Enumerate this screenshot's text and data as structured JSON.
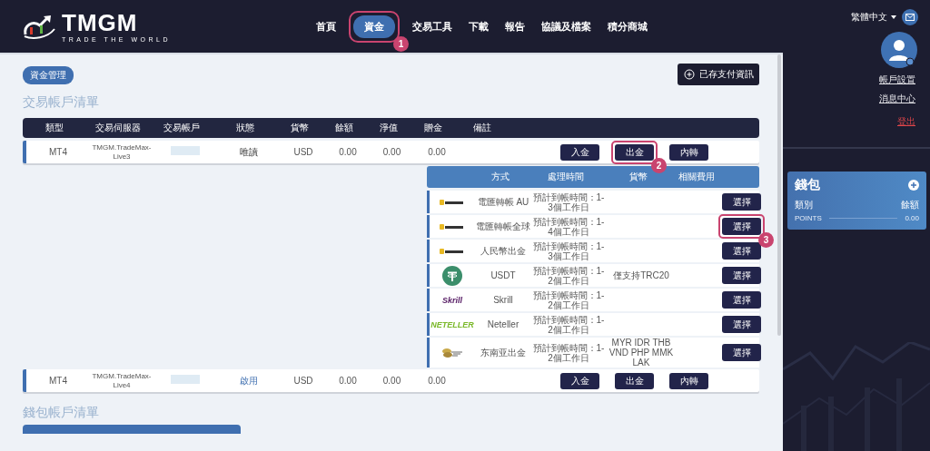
{
  "logo": {
    "name": "TMGM",
    "tagline": "TRADE THE WORLD"
  },
  "nav": [
    {
      "label": "首頁",
      "selected": false
    },
    {
      "label": "資金",
      "selected": true,
      "callout": "1"
    },
    {
      "label": "交易工具",
      "selected": false
    },
    {
      "label": "下載",
      "selected": false
    },
    {
      "label": "報告",
      "selected": false
    },
    {
      "label": "協議及檔案",
      "selected": false
    },
    {
      "label": "積分商城",
      "selected": false
    }
  ],
  "sidebar": {
    "language": "繁體中文",
    "links": [
      {
        "label": "帳戶設置",
        "kind": "normal"
      },
      {
        "label": "消息中心",
        "kind": "normal"
      },
      {
        "label": "登出",
        "kind": "danger"
      }
    ],
    "wallet": {
      "title": "錢包",
      "columns": [
        "類別",
        "餘額"
      ],
      "rows": [
        {
          "name": "POINTS",
          "balance": "0.00"
        }
      ]
    }
  },
  "breadcrumb": "資金管理",
  "saved_payment_button": "已存支付資訊",
  "trading_section_title": "交易帳戶清單",
  "table": {
    "columns": [
      "類型",
      "交易伺服器",
      "交易帳戶",
      "狀態",
      "貨幣",
      "餘額",
      "淨值",
      "贈金",
      "備註"
    ],
    "rows": [
      {
        "type": "MT4",
        "server": "TMGM.TradeMax-Live3",
        "status": "唯讀",
        "enabled": false,
        "currency": "USD",
        "balance": "0.00",
        "equity": "0.00",
        "bonus": "0.00",
        "expanded": true,
        "actions": [
          {
            "label": "入金"
          },
          {
            "label": "出金",
            "callout": "2"
          },
          {
            "label": "內轉"
          }
        ]
      },
      {
        "type": "MT4",
        "server": "TMGM.TradeMax-Live4",
        "status": "啟用",
        "enabled": true,
        "currency": "USD",
        "balance": "0.00",
        "equity": "0.00",
        "bonus": "0.00",
        "expanded": false,
        "actions": [
          {
            "label": "入金"
          },
          {
            "label": "出金"
          },
          {
            "label": "內轉"
          }
        ]
      }
    ]
  },
  "methods": {
    "columns": [
      "方式",
      "處理時間",
      "貨幣",
      "相關費用"
    ],
    "rows": [
      {
        "logo": {
          "kind": "card"
        },
        "name": "電匯轉帳 AU",
        "time": "預計到帳時間：1-3個工作日",
        "button": "選擇"
      },
      {
        "logo": {
          "kind": "card"
        },
        "name": "電匯轉帳全球",
        "time": "預計到帳時間：1-4個工作日",
        "button": "選擇",
        "callout": "3"
      },
      {
        "logo": {
          "kind": "card"
        },
        "name": "人民幣出金",
        "time": "預計到帳時間：1-3個工作日",
        "button": "選擇"
      },
      {
        "logo": {
          "kind": "tether"
        },
        "name": "USDT",
        "time": "預計到帳時間：1-2個工作日",
        "currency": "僅支持TRC20",
        "button": "選擇"
      },
      {
        "logo": {
          "kind": "wordmark",
          "text": "Skrill",
          "color": "#5a2168"
        },
        "name": "Skrill",
        "time": "預計到帳時間：1-2個工作日",
        "button": "選擇"
      },
      {
        "logo": {
          "kind": "wordmark",
          "text": "NETELLER",
          "color": "#7ab829"
        },
        "name": "Neteller",
        "time": "預計到帳時間：1-2個工作日",
        "button": "選擇"
      },
      {
        "logo": {
          "kind": "coins"
        },
        "name": "东南亚出金",
        "time": "預計到帳時間：1-2個工作日",
        "currency": "MYR IDR THB VND PHP MMK LAK",
        "button": "選擇"
      }
    ]
  },
  "wallet_section_title": "錢包帳戶清單"
}
